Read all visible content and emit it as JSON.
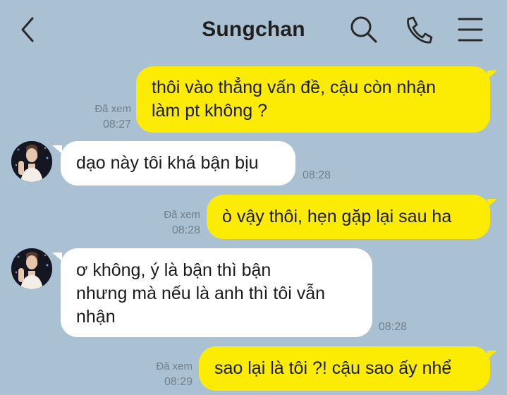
{
  "header": {
    "title": "Sungchan",
    "back_icon": "chevron-left-icon",
    "search_icon": "search-icon",
    "call_icon": "phone-icon",
    "menu_icon": "menu-icon"
  },
  "colors": {
    "background": "#a9c1d3",
    "outgoing_bubble": "#fcec04",
    "incoming_bubble": "#ffffff",
    "meta_text": "#6f7f8b"
  },
  "messages": [
    {
      "direction": "outgoing",
      "lines": [
        "thôi vào thẳng vấn đề, cậu còn nhận",
        "làm pt không ?"
      ],
      "read_label": "Đã xem",
      "time": "08:27"
    },
    {
      "direction": "incoming",
      "lines": [
        "dạo này tôi khá bận bịu"
      ],
      "time": "08:28"
    },
    {
      "direction": "outgoing",
      "lines": [
        "ò vậy thôi, hẹn gặp lại sau ha"
      ],
      "read_label": "Đã xem",
      "time": "08:28"
    },
    {
      "direction": "incoming",
      "lines": [
        "ơ không, ý là bận thì bận",
        "nhưng mà nếu là anh thì tôi vẫn",
        "nhận"
      ],
      "time": "08:28"
    },
    {
      "direction": "outgoing",
      "lines": [
        "sao lại là tôi ?! cậu sao ấy nhể"
      ],
      "read_label": "Đã xem",
      "time": "08:29"
    }
  ]
}
